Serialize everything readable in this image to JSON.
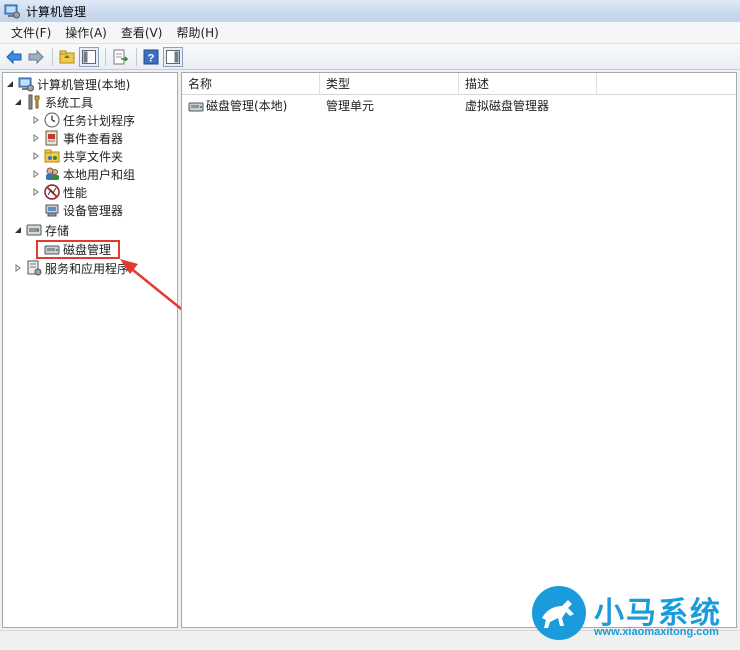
{
  "window": {
    "title": "计算机管理"
  },
  "menu": [
    {
      "label": "文件(F)"
    },
    {
      "label": "操作(A)"
    },
    {
      "label": "查看(V)"
    },
    {
      "label": "帮助(H)"
    }
  ],
  "tree": {
    "root": "计算机管理(本地)",
    "system_tools": "系统工具",
    "task_scheduler": "任务计划程序",
    "event_viewer": "事件查看器",
    "shared_folders": "共享文件夹",
    "local_users": "本地用户和组",
    "performance": "性能",
    "device_manager": "设备管理器",
    "storage": "存储",
    "disk_management": "磁盘管理",
    "services_apps": "服务和应用程序"
  },
  "list": {
    "columns": [
      "名称",
      "类型",
      "描述"
    ],
    "rows": [
      {
        "name": "磁盘管理(本地)",
        "type": "管理单元",
        "desc": "虚拟磁盘管理器"
      }
    ]
  },
  "watermark": {
    "brand": "小马系统",
    "url": "www.xiaomaxitong.com"
  },
  "colors": {
    "accent": "#1a9cdc",
    "highlight": "#e23b2e",
    "selection": "#cce8ff"
  }
}
